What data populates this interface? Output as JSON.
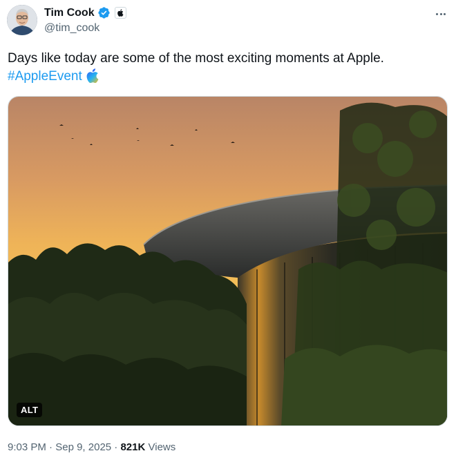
{
  "author": {
    "display_name": "Tim Cook",
    "handle": "@tim_cook",
    "verified_icon": "verified-badge-icon",
    "affiliate_icon": "apple-logo-icon"
  },
  "tweet": {
    "text": "Days like today are some of the most exciting moments at Apple.",
    "hashtag": "#AppleEvent",
    "hashflag_icon": "apple-event-hashflag-icon"
  },
  "media": {
    "alt_label": "ALT"
  },
  "meta": {
    "time": "9:03 PM",
    "separator1": "·",
    "date": "Sep 9, 2025",
    "separator2": "·",
    "views_count": "821K",
    "views_label": "Views"
  },
  "colors": {
    "link": "#1d9bf0",
    "secondary_text": "#536471",
    "verified": "#1d9bf0"
  }
}
